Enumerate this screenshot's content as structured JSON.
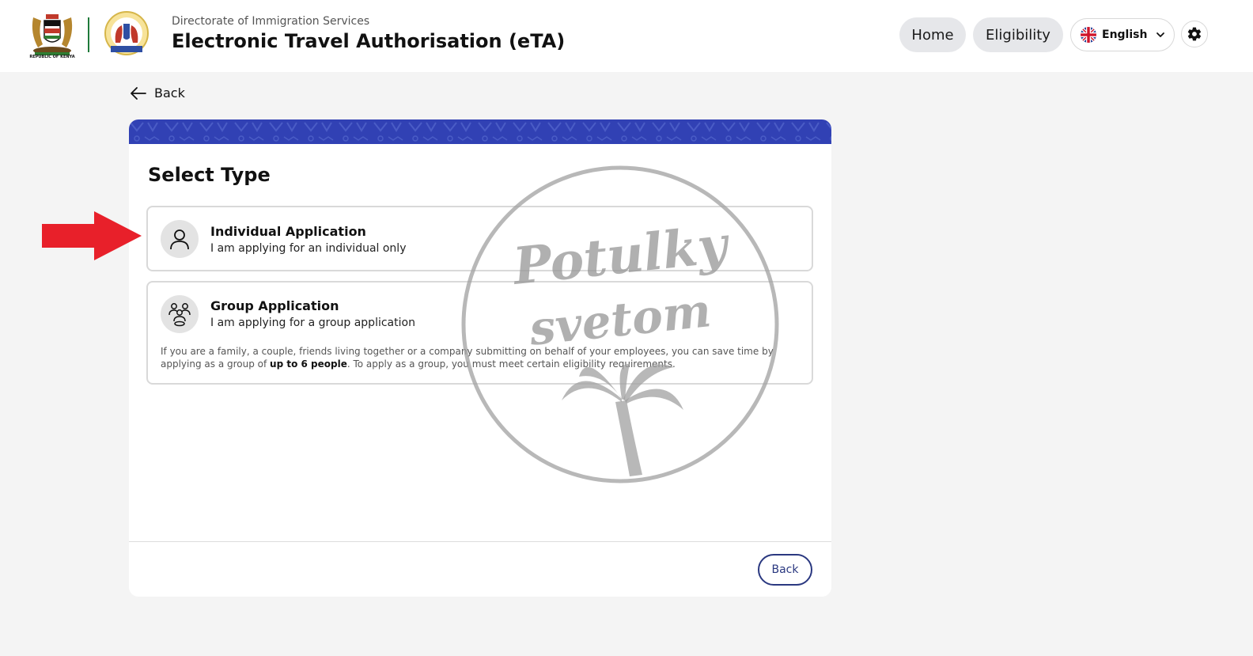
{
  "header": {
    "subtitle": "Directorate of Immigration Services",
    "title": "Electronic Travel Authorisation (eTA)",
    "coat_of_arms_caption": "REPUBLIC OF KENYA",
    "nav": {
      "home": "Home",
      "eligibility": "Eligibility"
    },
    "language": {
      "selected": "English",
      "flag_icon": "uk-flag-icon"
    },
    "settings_icon": "gear-icon"
  },
  "back_link": {
    "label": "Back",
    "icon": "arrow-left-icon"
  },
  "card": {
    "banner_color": "#3141b4",
    "title": "Select Type",
    "options": [
      {
        "title": "Individual Application",
        "description": "I am applying for an individual only",
        "icon": "person-icon"
      },
      {
        "title": "Group Application",
        "description": "I am applying for a group application",
        "icon": "group-icon",
        "note_before": "If you are a family, a couple, friends living together or a company submitting on behalf of your employees, you can save time by applying as a group of ",
        "note_bold": "up to 6 people",
        "note_after": ". To apply as a group, you must meet certain eligibility requirements."
      }
    ],
    "footer_back_label": "Back",
    "accent_color": "#2a3880"
  },
  "annotation": {
    "arrow_color": "#e8202a"
  },
  "watermark": {
    "line1": "Potulky",
    "line2": "svetom",
    "icon": "palm-tree-icon"
  }
}
